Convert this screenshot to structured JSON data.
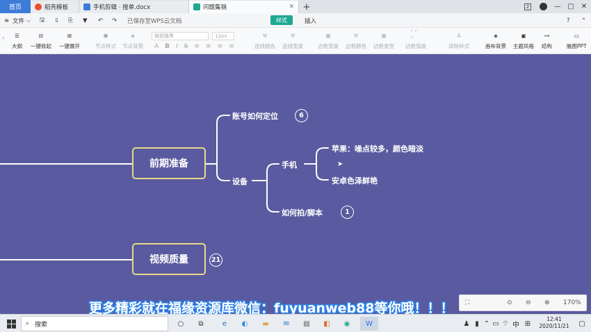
{
  "tabs": {
    "home": "首页",
    "items": [
      {
        "label": "稻壳模板",
        "color": "#e8512f"
      },
      {
        "label": "手机剪辑 · 搜单.docx",
        "color": "#3d7bd9"
      },
      {
        "label": "问题集锦",
        "color": "#1fa892"
      }
    ],
    "add_label": "+",
    "badge_count": "2"
  },
  "menu": {
    "file_label": "文件",
    "saved_status": "已保存至WPS云文档",
    "style_tab": "样式",
    "insert_tab": "插入"
  },
  "toolbar": {
    "outline": "大纲",
    "collapse_all": "一键收起",
    "expand_all": "一键展开",
    "node_style": "节点样式",
    "node_bg": "节点背景",
    "font_placeholder": "微软雅黑",
    "font_size": "12px",
    "line_color": "连线颜色",
    "line_width": "连线宽度",
    "border_width": "边框宽度",
    "border_color": "边框颜色",
    "border_type": "边框类型",
    "border_radius": "边框弧度",
    "clear_style": "清除样式",
    "canvas_bg": "画布背景",
    "theme_style": "主题风格",
    "structure": "结构",
    "map_ppt": "脑图PPT"
  },
  "mindmap": {
    "nodes": {
      "prep": "前期准备",
      "quality": "视频质量",
      "account": "账号如何定位",
      "account_count": "6",
      "device": "设备",
      "phone": "手机",
      "apple": "苹果：噪点较多，颜色暗淡",
      "android": "安卓色泽鲜艳",
      "shoot": "如何拍/脚本",
      "shoot_count": "1",
      "quality_count": "21"
    },
    "colors": {
      "canvas": "#5a5aa0",
      "line": "#ffffff",
      "main_border": "#e9d98a"
    }
  },
  "zoom": {
    "level": "170%"
  },
  "watermark": "更多精彩就在福缘资源库微信：fuyuanweb88等你哦！！！",
  "taskbar": {
    "search_placeholder": "搜索",
    "ime_label": "中",
    "time": "12:41",
    "date": "2020/11/21"
  }
}
